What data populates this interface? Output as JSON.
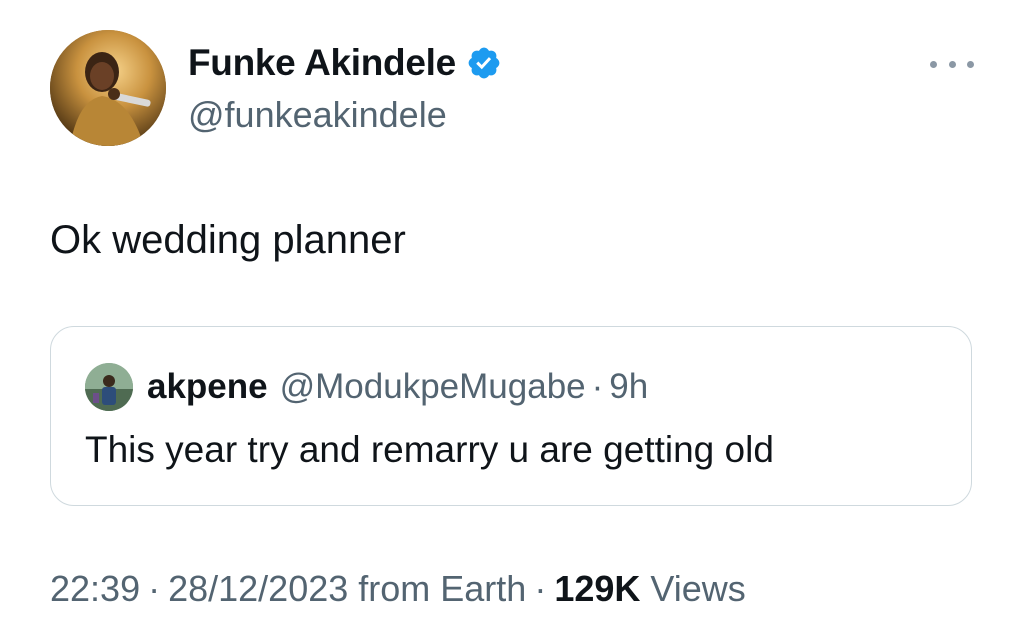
{
  "author": {
    "name": "Funke Akindele",
    "handle": "@funkeakindele",
    "verified_icon": "verified-badge-icon"
  },
  "tweet": {
    "text": "Ok wedding planner"
  },
  "quoted": {
    "name": "akpene",
    "handle": "@ModukpeMugabe",
    "separator": "·",
    "time": "9h",
    "text": "This year try and remarry u are getting old"
  },
  "meta": {
    "time": "22:39",
    "separator1": "·",
    "date": "28/12/2023 from Earth",
    "separator2": "·",
    "views_count": "129K",
    "views_label": "Views"
  },
  "colors": {
    "accent": "#1d9bf0",
    "text": "#0f1419",
    "secondary": "#536471",
    "border": "#cfd9de"
  },
  "icons": {
    "more": "more-horizontal-icon"
  }
}
